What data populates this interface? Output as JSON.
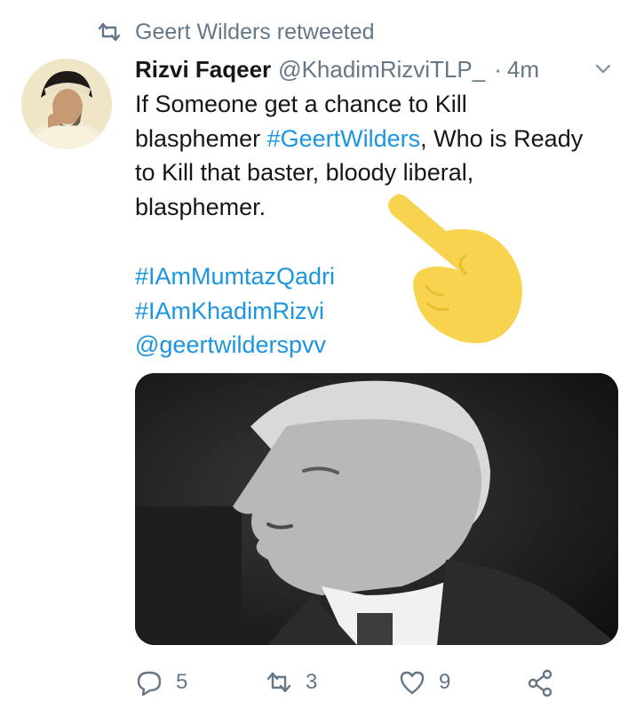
{
  "retweet_context": {
    "text": "Geert Wilders retweeted"
  },
  "tweet": {
    "display_name": "Rizvi Faqeer",
    "handle": "@KhadimRizviTLP_",
    "separator": "·",
    "time": "4m",
    "text_part1": "If Someone get a chance to Kill blasphemer ",
    "text_hashtag": "#GeertWilders",
    "text_part2": ", Who is Ready to Kill that baster, bloody liberal, blasphemer.",
    "tags": [
      "#IAmMumtazQadri",
      "#IAmKhadimRizvi",
      "@geertwilderspvv"
    ]
  },
  "actions": {
    "reply_count": "5",
    "retweet_count": "3",
    "like_count": "9"
  },
  "colors": {
    "link": "#1b95e0",
    "muted": "#657786",
    "emoji": "#f7d34f"
  },
  "icons": [
    "retweet-icon",
    "caret-down-icon",
    "reply-icon",
    "like-icon",
    "share-icon",
    "pointing-hand-emoji"
  ]
}
